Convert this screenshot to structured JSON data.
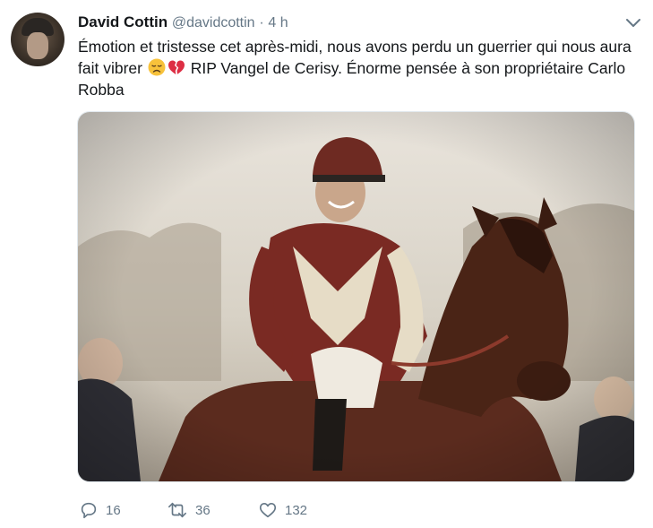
{
  "tweet": {
    "author_name": "David Cottin",
    "author_handle": "@davidcottin",
    "separator": "·",
    "time": "4 h",
    "text_part1": "Émotion et tristesse cet après-midi, nous avons perdu un guerrier qui nous aura fait vibrer ",
    "text_part2": " RIP Vangel de Cerisy. Énorme pensée à son propriétaire Carlo Robba",
    "emojis": [
      "disappointed-face-emoji",
      "broken-heart-emoji"
    ]
  },
  "actions": {
    "reply_count": "16",
    "retweet_count": "36",
    "like_count": "132"
  },
  "icons": {
    "chevron": "chevron-down-icon",
    "reply": "reply-icon",
    "retweet": "retweet-icon",
    "like": "heart-icon"
  },
  "colors": {
    "text": "#14171a",
    "secondary": "#657786",
    "border": "#e1e8ed"
  }
}
